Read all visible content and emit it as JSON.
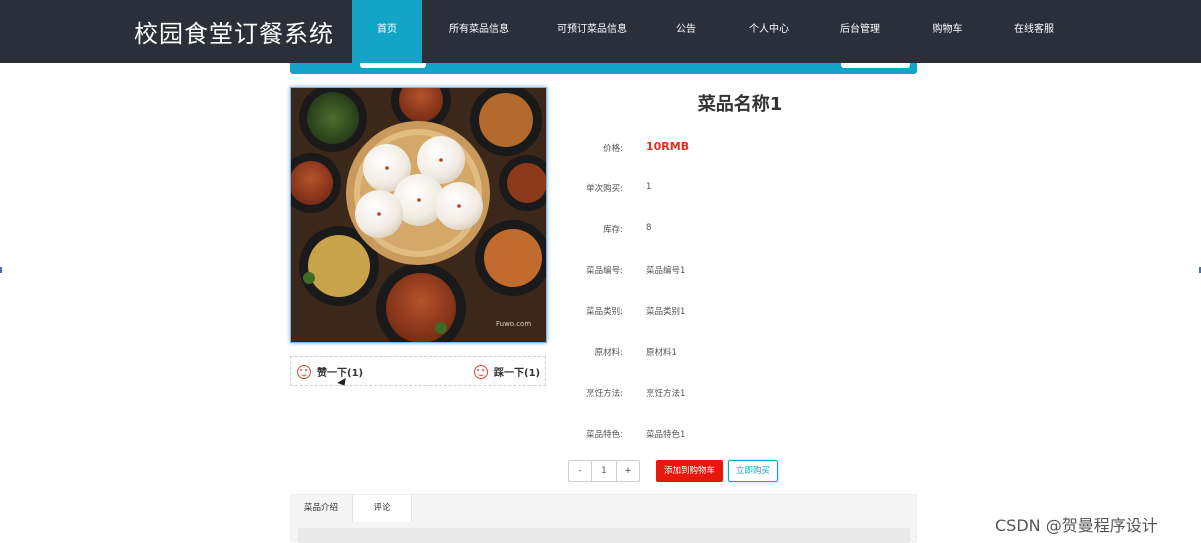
{
  "app": {
    "title": "校园食堂订餐系统"
  },
  "nav": {
    "items": [
      {
        "label": "首页",
        "active": true
      },
      {
        "label": "所有菜品信息",
        "active": false
      },
      {
        "label": "可预订菜品信息",
        "active": false
      },
      {
        "label": "公告",
        "active": false
      },
      {
        "label": "个人中心",
        "active": false
      },
      {
        "label": "后台管理",
        "active": false
      },
      {
        "label": "购物车",
        "active": false
      },
      {
        "label": "在线客服",
        "active": false
      }
    ]
  },
  "product": {
    "name": "菜品名称1",
    "fields": [
      {
        "label": "价格:",
        "value": "10RMB",
        "highlight": true
      },
      {
        "label": "单次购买:",
        "value": "1"
      },
      {
        "label": "库存:",
        "value": "8"
      },
      {
        "label": "菜品编号:",
        "value": "菜品编号1"
      },
      {
        "label": "菜品类别:",
        "value": "菜品类别1"
      },
      {
        "label": "原材料:",
        "value": "原材料1"
      },
      {
        "label": "烹饪方法:",
        "value": "烹饪方法1"
      },
      {
        "label": "菜品特色:",
        "value": "菜品特色1"
      }
    ],
    "image_watermark": "Fuwo.com"
  },
  "votes": {
    "like_label": "赞一下(1)",
    "dislike_label": "踩一下(1)"
  },
  "purchase": {
    "minus": "-",
    "quantity": "1",
    "plus": "+",
    "add_cart_label": "添加到购物车",
    "buy_now_label": "立即购买"
  },
  "tabs": [
    {
      "label": "菜品介绍",
      "active": false
    },
    {
      "label": "评论",
      "active": true
    }
  ],
  "watermark": "CSDN @贺曼程序设计",
  "colors": {
    "nav_bg": "#2b2f3a",
    "accent": "#13a4c8",
    "price": "#e0301e",
    "cart_button": "#e6170d"
  }
}
